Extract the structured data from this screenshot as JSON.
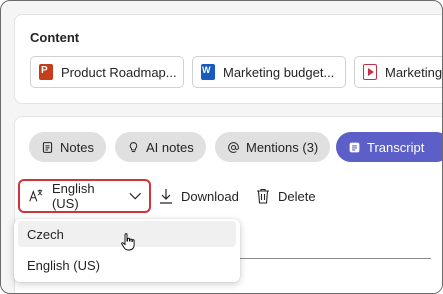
{
  "content": {
    "title": "Content",
    "files": [
      {
        "name": "Product Roadmap...",
        "icon": "powerpoint-icon"
      },
      {
        "name": "Marketing budget...",
        "icon": "word-icon"
      },
      {
        "name": "Marketing",
        "icon": "video-icon"
      }
    ]
  },
  "tabs": [
    {
      "label": "Notes",
      "icon": "notes-icon"
    },
    {
      "label": "AI notes",
      "icon": "lightbulb-icon"
    },
    {
      "label": "Mentions (3)",
      "icon": "at-icon"
    },
    {
      "label": "Transcript",
      "icon": "transcript-icon",
      "active": true
    }
  ],
  "toolbar": {
    "language": "English (US)",
    "download": "Download",
    "delete": "Delete"
  },
  "language_menu": {
    "options": [
      "Czech",
      "English (US)"
    ],
    "hovered": "Czech"
  },
  "colors": {
    "accent": "#5b5fc7",
    "highlight_border": "#d13438"
  }
}
